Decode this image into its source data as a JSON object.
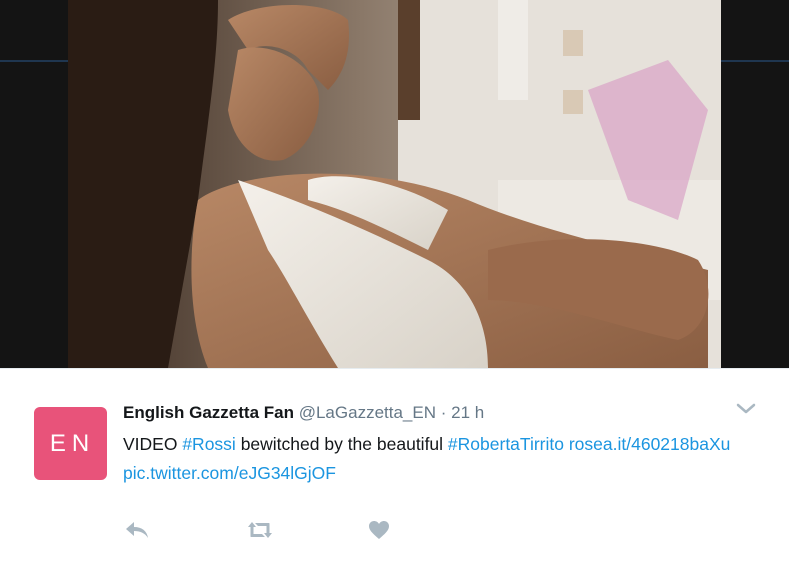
{
  "tweet": {
    "avatar_initials": "EN",
    "display_name": "English Gazzetta Fan",
    "handle": "@LaGazzetta_EN",
    "separator": "·",
    "timestamp": "21 h",
    "text_prefix": "VIDEO ",
    "hashtag_1": "#Rossi",
    "text_middle": " bewitched by the beautiful ",
    "hashtag_2": "#RobertaTirrito",
    "link_1": "rosea.it/460218baXu",
    "link_2": "pic.twitter.com/eJG34lGjOF"
  },
  "icons": {
    "options": "chevron-down-icon",
    "reply": "reply-icon",
    "retweet": "retweet-icon",
    "like": "heart-icon"
  },
  "colors": {
    "avatar_bg": "#e8537a",
    "link": "#1b95e0",
    "action_icon": "#aab8c2"
  }
}
